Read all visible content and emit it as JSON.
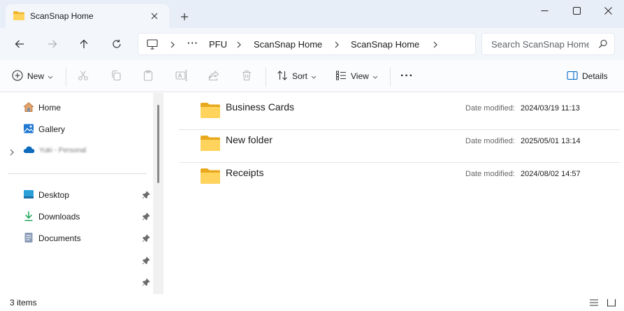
{
  "window": {
    "tab_title": "ScanSnap Home",
    "tab_icon": "folder-icon",
    "accent_color": "#0067c0",
    "folder_color": "#f5c451"
  },
  "nav": {
    "more_label": "···",
    "breadcrumbs": [
      "PFU",
      "ScanSnap Home",
      "ScanSnap Home"
    ]
  },
  "search": {
    "placeholder": "Search ScanSnap Home"
  },
  "toolbar": {
    "new_label": "New",
    "sort_label": "Sort",
    "view_label": "View",
    "more_label": "···",
    "details_label": "Details"
  },
  "sidebar": {
    "home": "Home",
    "gallery": "Gallery",
    "onedrive": "Yuki - Personal",
    "desktop": "Desktop",
    "downloads": "Downloads",
    "documents": "Documents"
  },
  "files": [
    {
      "name": "Business Cards",
      "date_label": "Date modified:",
      "date": "2024/03/19 11:13"
    },
    {
      "name": "New folder",
      "date_label": "Date modified:",
      "date": "2025/05/01 13:14"
    },
    {
      "name": "Receipts",
      "date_label": "Date modified:",
      "date": "2024/08/02 14:57"
    }
  ],
  "status": {
    "item_count": "3 items"
  }
}
